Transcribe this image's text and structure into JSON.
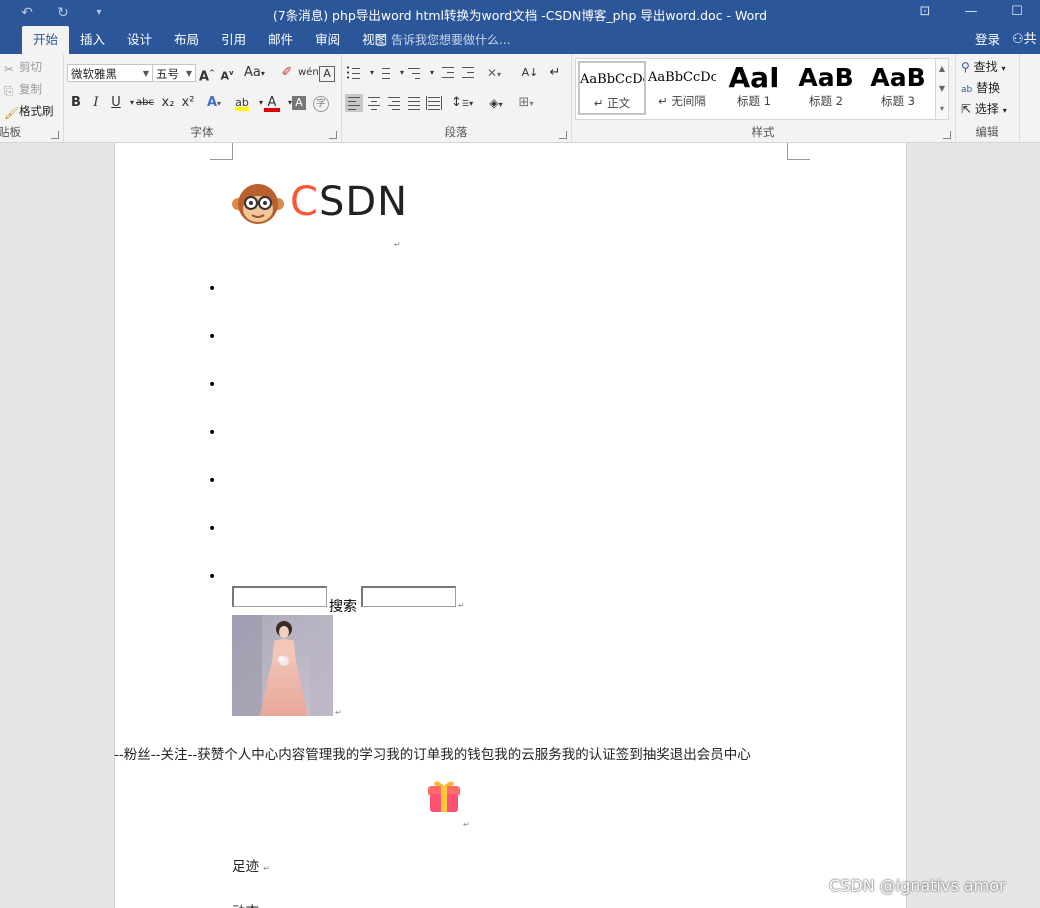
{
  "window": {
    "title": "(7条消息) php导出word html转换为word文档 -CSDN博客_php 导出word.doc - Word",
    "accent": "#2b579a"
  },
  "quick_access": [
    "undo-icon",
    "redo-icon",
    "customize-icon"
  ],
  "tabs": [
    "开始",
    "插入",
    "设计",
    "布局",
    "引用",
    "邮件",
    "审阅",
    "视图"
  ],
  "active_tab": "开始",
  "tell_me": "告诉我您想要做什么...",
  "account": {
    "login": "登录",
    "share_glyph": "共"
  },
  "clipboard": {
    "label": "剪贴板",
    "visible_label": "贴板",
    "items": [
      "剪切",
      "复制",
      "格式刷"
    ]
  },
  "font": {
    "label": "字体",
    "family": "微软雅黑",
    "size": "五号",
    "buttons": [
      "A",
      "A",
      "Aa",
      "B",
      "I",
      "U",
      "abc",
      "x₂",
      "x²",
      "A",
      "A",
      "A",
      "字"
    ],
    "highlight_color": "#ffff00",
    "font_color": "#e00000"
  },
  "paragraph": {
    "label": "段落"
  },
  "styles": {
    "label": "样式",
    "items": [
      {
        "sample": "AaBbCcDc",
        "name": "↵ 正文"
      },
      {
        "sample": "AaBbCcDc",
        "name": "↵ 无间隔"
      },
      {
        "sample": "AaI",
        "name": "标题 1"
      },
      {
        "sample": "AaB",
        "name": "标题 2"
      },
      {
        "sample": "AaB",
        "name": "标题 3"
      }
    ]
  },
  "editing": {
    "label": "编辑",
    "items": [
      "查找",
      "替换",
      "选择"
    ]
  },
  "document": {
    "logo": {
      "c": "C",
      "rest": "SDN"
    },
    "para_mark": "↵",
    "bullets": [
      "",
      "",
      "",
      "",
      "",
      "",
      ""
    ],
    "search_button": "搜索",
    "links_line": "--粉丝--关注--获赞个人中心内容管理我的学习我的订单我的钱包我的云服务我的认证签到抽奖退出会员中心",
    "footprint": "足迹",
    "next_line_partial": "动态"
  },
  "watermark": "CSDN @ignativs  amor"
}
